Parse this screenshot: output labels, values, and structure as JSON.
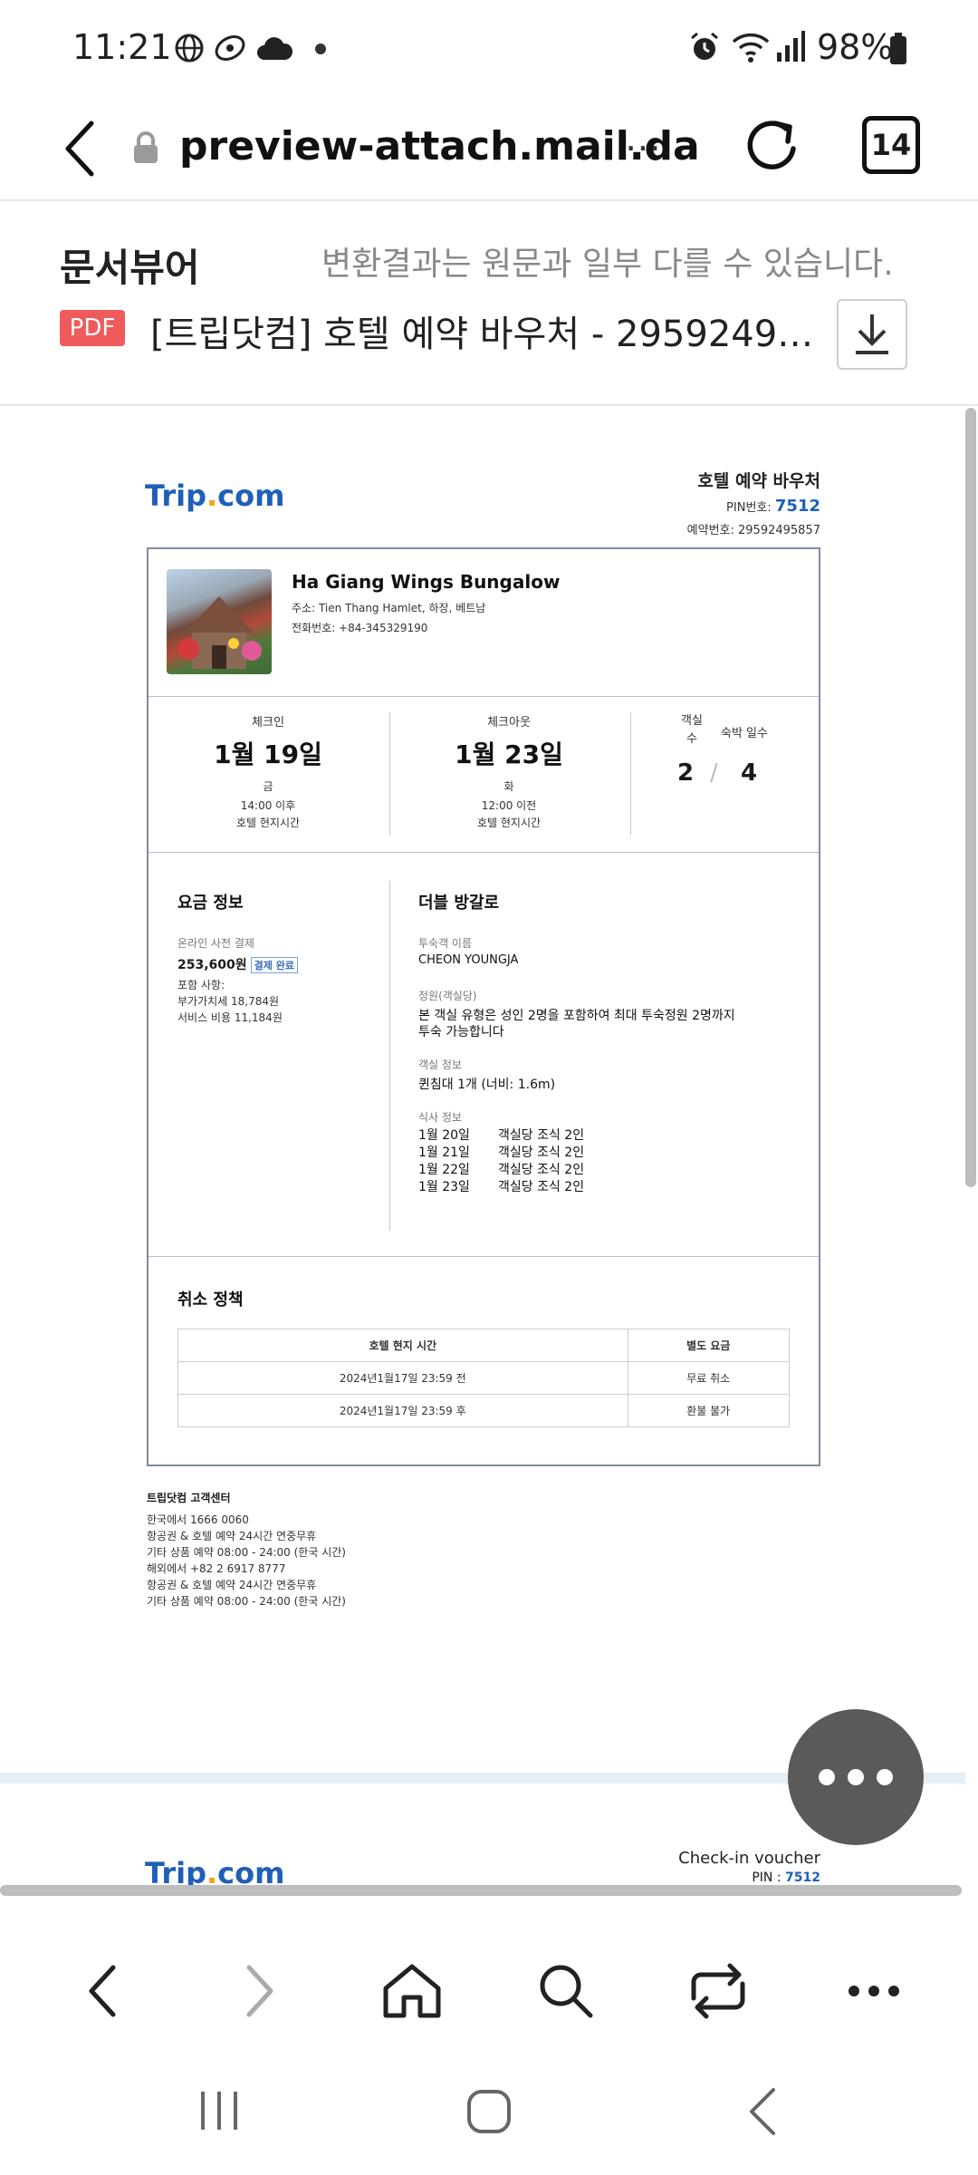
{
  "status_bar": {
    "time": "11:21",
    "battery": "98%"
  },
  "browser": {
    "url": "preview-attach.mail.da",
    "tab_count": "14"
  },
  "viewer": {
    "title": "문서뷰어",
    "note": "변환결과는 원문과 일부 다를 수 있습니다.",
    "file_badge": "PDF",
    "file_name": "[트립닷컴] 호텔 예약 바우처 - 295924958..."
  },
  "voucher": {
    "logo_main": "Trip",
    "logo_dot": ".",
    "logo_tail": "com",
    "doc_title": "호텔 예약 바우처",
    "pin_label": "PIN번호: ",
    "pin_value": "7512",
    "booking_no": "예약번호: 29592495857",
    "hotel": {
      "name": "Ha Giang Wings Bungalow",
      "address": "주소: Tien Thang Hamlet, 하장, 베트남",
      "phone": "전화번호: +84-345329190"
    },
    "checkin": {
      "label": "체크인",
      "date": "1월 19일",
      "weekday": "금",
      "time": "14:00 이후",
      "tz": "호텔 현지시간"
    },
    "checkout": {
      "label": "체크아웃",
      "date": "1월 23일",
      "weekday": "화",
      "time": "12:00 이전",
      "tz": "호텔 현지시간"
    },
    "rooms": {
      "rooms_label_1": "객실",
      "rooms_label_2": "수",
      "nights_label": "숙박 일수",
      "rooms_value": "2",
      "separator": "/",
      "nights_value": "4"
    },
    "price": {
      "title": "요금 정보",
      "prepay_label": "온라인 사전 결제",
      "amount": "253,600원",
      "paid_badge": "결제 완료",
      "includes": "포함 사항:",
      "vat": "부가가치세 18,784원",
      "service": "서비스 비용 11,184원"
    },
    "room": {
      "title": "더블 방갈로",
      "guest_label": "투숙객 이름",
      "guest_name": "CHEON YOUNGJA",
      "capacity_label": "정원(객실당)",
      "capacity_text_1": "본 객실 유형은 성인 2명을 포함하여 최대 투숙정원 2명까지",
      "capacity_text_2": "투숙 가능합니다",
      "info_label": "객실 정보",
      "info_text": "퀸침대 1개 (너비: 1.6m)",
      "meal_label": "식사 정보",
      "meals": [
        {
          "date": "1월 20일",
          "desc": "객실당 조식 2인"
        },
        {
          "date": "1월 21일",
          "desc": "객실당 조식 2인"
        },
        {
          "date": "1월 22일",
          "desc": "객실당 조식 2인"
        },
        {
          "date": "1월 23일",
          "desc": "객실당 조식 2인"
        }
      ]
    },
    "cancel": {
      "title": "취소 정책",
      "col1": "호텔 현지 시간",
      "col2": "별도 요금",
      "rows": [
        {
          "time": "2024년1월17일 23:59 전",
          "fee": "무료 취소"
        },
        {
          "time": "2024년1월17일 23:59 후",
          "fee": "환불 불가"
        }
      ]
    },
    "support": {
      "title": "트립닷컴 고객센터",
      "lines": [
        "한국에서 1666 0060",
        "항공권 & 호텔 예약 24시간 연중무휴",
        "기타 상품 예약 08:00 - 24:00 (한국 시간)",
        "해외에서 +82 2 6917 8777",
        "항공권 & 호텔 예약 24시간 연중무휴",
        "기타 상품 예약 08:00 - 24:00 (한국 시간)"
      ]
    },
    "next_page": {
      "title": "Check-in voucher",
      "pin_label": "PIN : ",
      "pin_value": "7512"
    }
  },
  "icon_names": [
    "globe-icon",
    "cloud-icon",
    "alarm-icon",
    "wifi-icon",
    "signal-icon",
    "battery-icon",
    "back-arrow-icon",
    "lock-icon",
    "more-icon",
    "reload-icon",
    "download-icon",
    "more-dots-icon",
    "nav-back-icon",
    "nav-forward-icon",
    "home-icon",
    "search-icon",
    "tabs-icon",
    "menu-icon",
    "recents-icon",
    "home-circle-icon",
    "system-back-icon"
  ],
  "colors": {
    "accent_blue": "#1f5fb8",
    "pdf_red": "#ef5a5a",
    "fab_gray": "#5a5a5a"
  }
}
